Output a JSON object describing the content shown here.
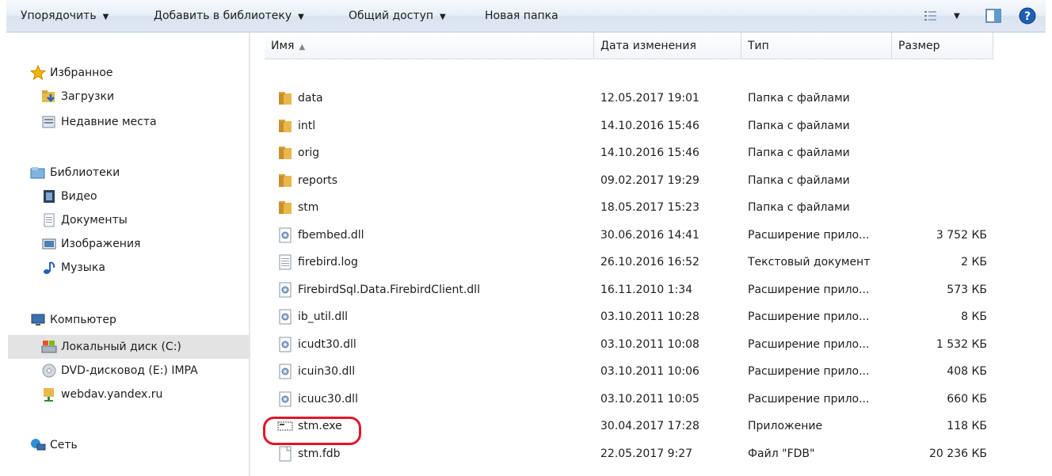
{
  "toolbar": {
    "organize": "Упорядочить",
    "add_library": "Добавить в библиотеку",
    "share": "Общий доступ",
    "new_folder": "Новая папка"
  },
  "nav": {
    "favorites": "Избранное",
    "downloads": "Загрузки",
    "recent": "Недавние места",
    "libraries": "Библиотеки",
    "video": "Видео",
    "documents": "Документы",
    "images": "Изображения",
    "music": "Музыка",
    "computer": "Компьютер",
    "local_disk": "Локальный диск (C:)",
    "dvd": "DVD-дисковод (E:) IMPA",
    "webdav": "webdav.yandex.ru",
    "network": "Сеть"
  },
  "columns": {
    "name": "Имя",
    "modified": "Дата изменения",
    "type": "Тип",
    "size": "Размер"
  },
  "files": [
    {
      "name": "data",
      "date": "12.05.2017 19:01",
      "type": "Папка с файлами",
      "size": "",
      "icon": "folder"
    },
    {
      "name": "intl",
      "date": "14.10.2016 15:46",
      "type": "Папка с файлами",
      "size": "",
      "icon": "folder"
    },
    {
      "name": "orig",
      "date": "14.10.2016 15:46",
      "type": "Папка с файлами",
      "size": "",
      "icon": "folder"
    },
    {
      "name": "reports",
      "date": "09.02.2017 19:29",
      "type": "Папка с файлами",
      "size": "",
      "icon": "folder"
    },
    {
      "name": "stm",
      "date": "18.05.2017 15:23",
      "type": "Папка с файлами",
      "size": "",
      "icon": "folder"
    },
    {
      "name": "fbembed.dll",
      "date": "30.06.2016 14:41",
      "type": "Расширение прило...",
      "size": "3 752 КБ",
      "icon": "dll"
    },
    {
      "name": "firebird.log",
      "date": "26.10.2016 16:52",
      "type": "Текстовый документ",
      "size": "2 КБ",
      "icon": "text"
    },
    {
      "name": "FirebirdSql.Data.FirebirdClient.dll",
      "date": "16.11.2010 1:34",
      "type": "Расширение прило...",
      "size": "573 КБ",
      "icon": "dll"
    },
    {
      "name": "ib_util.dll",
      "date": "03.10.2011 10:28",
      "type": "Расширение прило...",
      "size": "8 КБ",
      "icon": "dll"
    },
    {
      "name": "icudt30.dll",
      "date": "03.10.2011 10:08",
      "type": "Расширение прило...",
      "size": "1 532 КБ",
      "icon": "dll"
    },
    {
      "name": "icuin30.dll",
      "date": "03.10.2011 10:06",
      "type": "Расширение прило...",
      "size": "408 КБ",
      "icon": "dll"
    },
    {
      "name": "icuuc30.dll",
      "date": "03.10.2011 10:05",
      "type": "Расширение прило...",
      "size": "660 КБ",
      "icon": "dll"
    },
    {
      "name": "stm.exe",
      "date": "30.04.2017 17:28",
      "type": "Приложение",
      "size": "118 КБ",
      "icon": "exe"
    },
    {
      "name": "stm.fdb",
      "date": "22.05.2017 9:27",
      "type": "Файл \"FDB\"",
      "size": "20 236 КБ",
      "icon": "blank"
    }
  ],
  "colors": {
    "highlight": "#e0162b",
    "folder": "#e8b84a"
  }
}
